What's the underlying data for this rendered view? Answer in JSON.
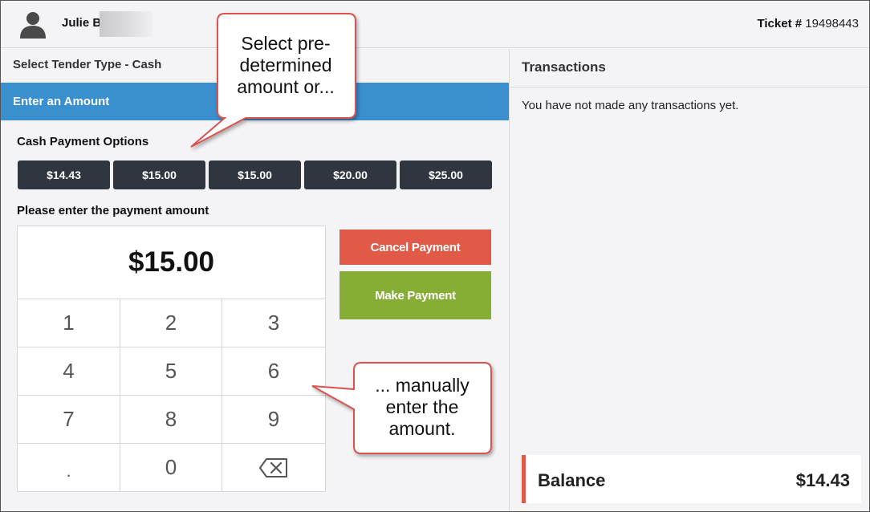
{
  "header": {
    "user_name": "Julie B",
    "ticket_label": "Ticket #",
    "ticket_number": "19498443"
  },
  "left": {
    "tender_type": "Select Tender Type - Cash",
    "amount_bar": "Enter an Amount",
    "cash_options_label": "Cash Payment Options",
    "cash_options": [
      "$14.43",
      "$15.00",
      "$15.00",
      "$20.00",
      "$25.00"
    ],
    "enter_label": "Please enter the payment amount",
    "display_amount": "$15.00",
    "keys": [
      "1",
      "2",
      "3",
      "4",
      "5",
      "6",
      "7",
      "8",
      "9",
      ".",
      "0"
    ],
    "cancel_label": "Cancel Payment",
    "make_label": "Make Payment"
  },
  "right": {
    "title": "Transactions",
    "empty_message": "You have not made any transactions yet.",
    "balance_label": "Balance",
    "balance_value": "$14.43"
  },
  "callouts": {
    "top": [
      "Select pre-",
      "determined",
      "amount or..."
    ],
    "bottom": [
      "... manually",
      "enter the",
      "amount."
    ]
  },
  "colors": {
    "accent_blue": "#3a8fce",
    "cancel_red": "#e05a47",
    "make_green": "#86ae37",
    "dark_button": "#2f3640"
  },
  "icons": {
    "avatar": "user-silhouette-icon",
    "backspace": "backspace-icon"
  }
}
